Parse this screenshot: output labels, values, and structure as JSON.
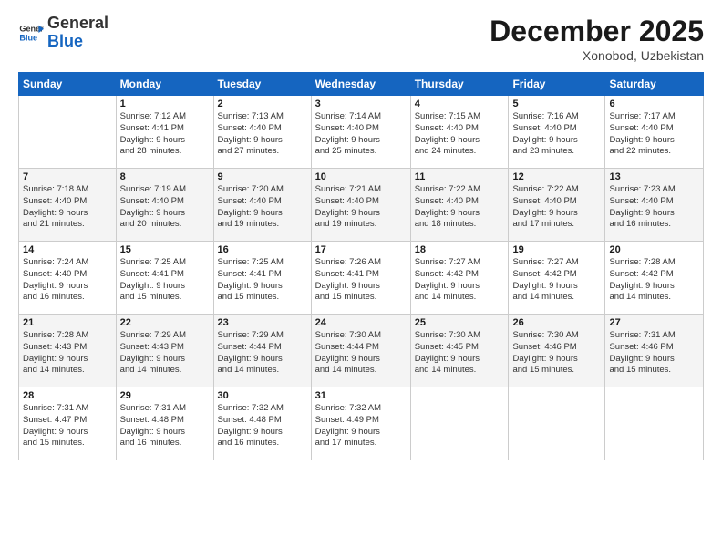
{
  "logo": {
    "line1": "General",
    "line2": "Blue"
  },
  "title": "December 2025",
  "location": "Xonobod, Uzbekistan",
  "days_header": [
    "Sunday",
    "Monday",
    "Tuesday",
    "Wednesday",
    "Thursday",
    "Friday",
    "Saturday"
  ],
  "weeks": [
    [
      {
        "day": "",
        "info": ""
      },
      {
        "day": "1",
        "info": "Sunrise: 7:12 AM\nSunset: 4:41 PM\nDaylight: 9 hours\nand 28 minutes."
      },
      {
        "day": "2",
        "info": "Sunrise: 7:13 AM\nSunset: 4:40 PM\nDaylight: 9 hours\nand 27 minutes."
      },
      {
        "day": "3",
        "info": "Sunrise: 7:14 AM\nSunset: 4:40 PM\nDaylight: 9 hours\nand 25 minutes."
      },
      {
        "day": "4",
        "info": "Sunrise: 7:15 AM\nSunset: 4:40 PM\nDaylight: 9 hours\nand 24 minutes."
      },
      {
        "day": "5",
        "info": "Sunrise: 7:16 AM\nSunset: 4:40 PM\nDaylight: 9 hours\nand 23 minutes."
      },
      {
        "day": "6",
        "info": "Sunrise: 7:17 AM\nSunset: 4:40 PM\nDaylight: 9 hours\nand 22 minutes."
      }
    ],
    [
      {
        "day": "7",
        "info": "Sunrise: 7:18 AM\nSunset: 4:40 PM\nDaylight: 9 hours\nand 21 minutes."
      },
      {
        "day": "8",
        "info": "Sunrise: 7:19 AM\nSunset: 4:40 PM\nDaylight: 9 hours\nand 20 minutes."
      },
      {
        "day": "9",
        "info": "Sunrise: 7:20 AM\nSunset: 4:40 PM\nDaylight: 9 hours\nand 19 minutes."
      },
      {
        "day": "10",
        "info": "Sunrise: 7:21 AM\nSunset: 4:40 PM\nDaylight: 9 hours\nand 19 minutes."
      },
      {
        "day": "11",
        "info": "Sunrise: 7:22 AM\nSunset: 4:40 PM\nDaylight: 9 hours\nand 18 minutes."
      },
      {
        "day": "12",
        "info": "Sunrise: 7:22 AM\nSunset: 4:40 PM\nDaylight: 9 hours\nand 17 minutes."
      },
      {
        "day": "13",
        "info": "Sunrise: 7:23 AM\nSunset: 4:40 PM\nDaylight: 9 hours\nand 16 minutes."
      }
    ],
    [
      {
        "day": "14",
        "info": "Sunrise: 7:24 AM\nSunset: 4:40 PM\nDaylight: 9 hours\nand 16 minutes."
      },
      {
        "day": "15",
        "info": "Sunrise: 7:25 AM\nSunset: 4:41 PM\nDaylight: 9 hours\nand 15 minutes."
      },
      {
        "day": "16",
        "info": "Sunrise: 7:25 AM\nSunset: 4:41 PM\nDaylight: 9 hours\nand 15 minutes."
      },
      {
        "day": "17",
        "info": "Sunrise: 7:26 AM\nSunset: 4:41 PM\nDaylight: 9 hours\nand 15 minutes."
      },
      {
        "day": "18",
        "info": "Sunrise: 7:27 AM\nSunset: 4:42 PM\nDaylight: 9 hours\nand 14 minutes."
      },
      {
        "day": "19",
        "info": "Sunrise: 7:27 AM\nSunset: 4:42 PM\nDaylight: 9 hours\nand 14 minutes."
      },
      {
        "day": "20",
        "info": "Sunrise: 7:28 AM\nSunset: 4:42 PM\nDaylight: 9 hours\nand 14 minutes."
      }
    ],
    [
      {
        "day": "21",
        "info": "Sunrise: 7:28 AM\nSunset: 4:43 PM\nDaylight: 9 hours\nand 14 minutes."
      },
      {
        "day": "22",
        "info": "Sunrise: 7:29 AM\nSunset: 4:43 PM\nDaylight: 9 hours\nand 14 minutes."
      },
      {
        "day": "23",
        "info": "Sunrise: 7:29 AM\nSunset: 4:44 PM\nDaylight: 9 hours\nand 14 minutes."
      },
      {
        "day": "24",
        "info": "Sunrise: 7:30 AM\nSunset: 4:44 PM\nDaylight: 9 hours\nand 14 minutes."
      },
      {
        "day": "25",
        "info": "Sunrise: 7:30 AM\nSunset: 4:45 PM\nDaylight: 9 hours\nand 14 minutes."
      },
      {
        "day": "26",
        "info": "Sunrise: 7:30 AM\nSunset: 4:46 PM\nDaylight: 9 hours\nand 15 minutes."
      },
      {
        "day": "27",
        "info": "Sunrise: 7:31 AM\nSunset: 4:46 PM\nDaylight: 9 hours\nand 15 minutes."
      }
    ],
    [
      {
        "day": "28",
        "info": "Sunrise: 7:31 AM\nSunset: 4:47 PM\nDaylight: 9 hours\nand 15 minutes."
      },
      {
        "day": "29",
        "info": "Sunrise: 7:31 AM\nSunset: 4:48 PM\nDaylight: 9 hours\nand 16 minutes."
      },
      {
        "day": "30",
        "info": "Sunrise: 7:32 AM\nSunset: 4:48 PM\nDaylight: 9 hours\nand 16 minutes."
      },
      {
        "day": "31",
        "info": "Sunrise: 7:32 AM\nSunset: 4:49 PM\nDaylight: 9 hours\nand 17 minutes."
      },
      {
        "day": "",
        "info": ""
      },
      {
        "day": "",
        "info": ""
      },
      {
        "day": "",
        "info": ""
      }
    ]
  ]
}
